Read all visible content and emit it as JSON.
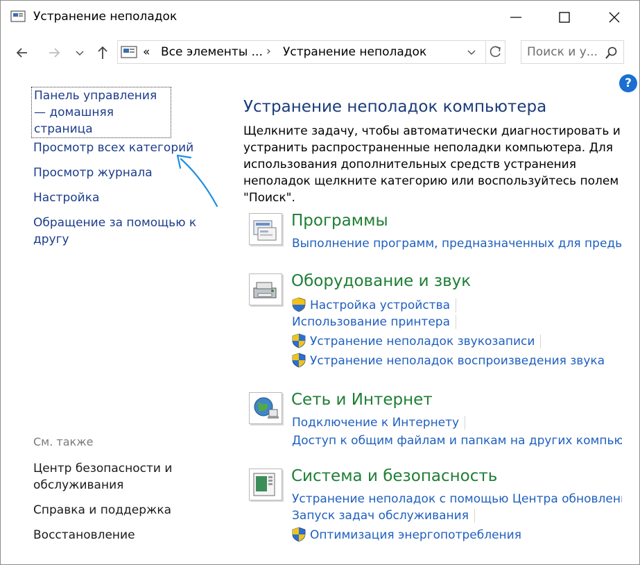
{
  "window": {
    "title": "Устранение неполадок",
    "title_icon": "control-panel-icon"
  },
  "nav": {
    "breadcrumb_prefix": "«",
    "breadcrumb_1": "Все элементы ...",
    "breadcrumb_sep": "›",
    "breadcrumb_2": "Устранение неполадок",
    "search_placeholder": "Поиск и у..."
  },
  "help_label": "?",
  "left_pane": {
    "home_link": "Панель управления — домашняя страница",
    "links": [
      "Просмотр всех категорий",
      "Просмотр журнала",
      "Настройка",
      "Обращение за помощью к другу"
    ],
    "see_also": "См. также",
    "see_also_links": [
      "Центр безопасности и обслуживания",
      "Справка и поддержка",
      "Восстановление"
    ]
  },
  "main": {
    "title": "Устранение неполадок компьютера",
    "description": "Щелкните задачу, чтобы автоматически диагностировать и устранить распространенные неполадки компьютера. Для использования дополнительных средств устранения неполадок щелкните категорию или воспользуйтесь полем \"Поиск\".",
    "categories": [
      {
        "title": "Программы",
        "icon": "programs-icon",
        "links": [
          {
            "label": "Выполнение программ, предназначенных для предыду",
            "shield": false
          }
        ]
      },
      {
        "title": "Оборудование и звук",
        "icon": "hardware-sound-icon",
        "links": [
          {
            "label": "Настройка устройства",
            "shield": true
          },
          {
            "label": "Использование принтера",
            "shield": false
          },
          {
            "label": "Устранение неполадок звукозаписи",
            "shield": true
          },
          {
            "label": "Устранение неполадок воспроизведения звука",
            "shield": true
          }
        ]
      },
      {
        "title": "Сеть и Интернет",
        "icon": "network-globe-icon",
        "links": [
          {
            "label": "Подключение к Интернету",
            "shield": false
          },
          {
            "label": "Доступ к общим файлам и папкам на других компьюте",
            "shield": false
          }
        ]
      },
      {
        "title": "Система и безопасность",
        "icon": "system-security-icon",
        "links": [
          {
            "label": "Устранение неполадок с помощью Центра обновления",
            "shield": false
          },
          {
            "label": "Запуск задач обслуживания",
            "shield": false
          },
          {
            "label": "Оптимизация энергопотребления",
            "shield": true
          }
        ]
      }
    ]
  },
  "colors": {
    "link": "#1f5fbf",
    "category_title": "#1e7e34",
    "heading": "#1b3b7a",
    "annotation_arrow": "#1f8fe0"
  }
}
